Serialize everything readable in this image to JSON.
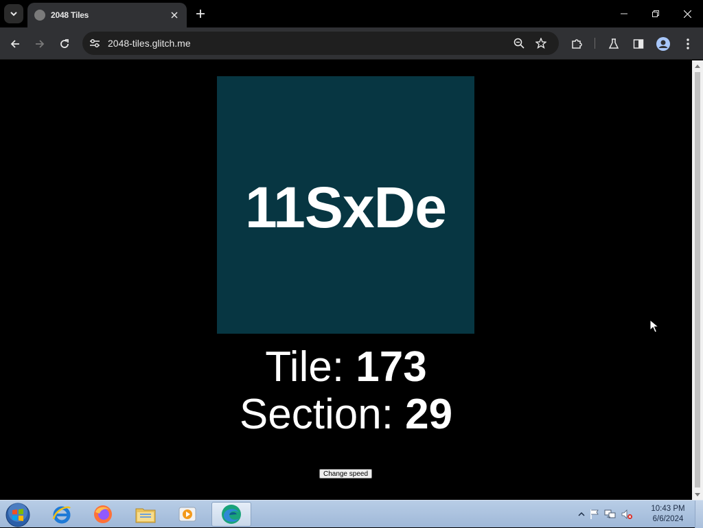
{
  "browser": {
    "tab_title": "2048 Tiles",
    "url": "2048-tiles.glitch.me"
  },
  "page": {
    "tile_text": "11SxDe",
    "tile_color": "#073642",
    "tile_label": "Tile: ",
    "tile_value": "173",
    "section_label": "Section: ",
    "section_value": "29",
    "change_speed_label": "Change speed"
  },
  "taskbar": {
    "time": "10:43 PM",
    "date": "6/6/2024",
    "pinned": [
      "internet-explorer-icon",
      "firefox-icon",
      "file-explorer-icon",
      "media-player-icon",
      "edge-icon"
    ]
  }
}
